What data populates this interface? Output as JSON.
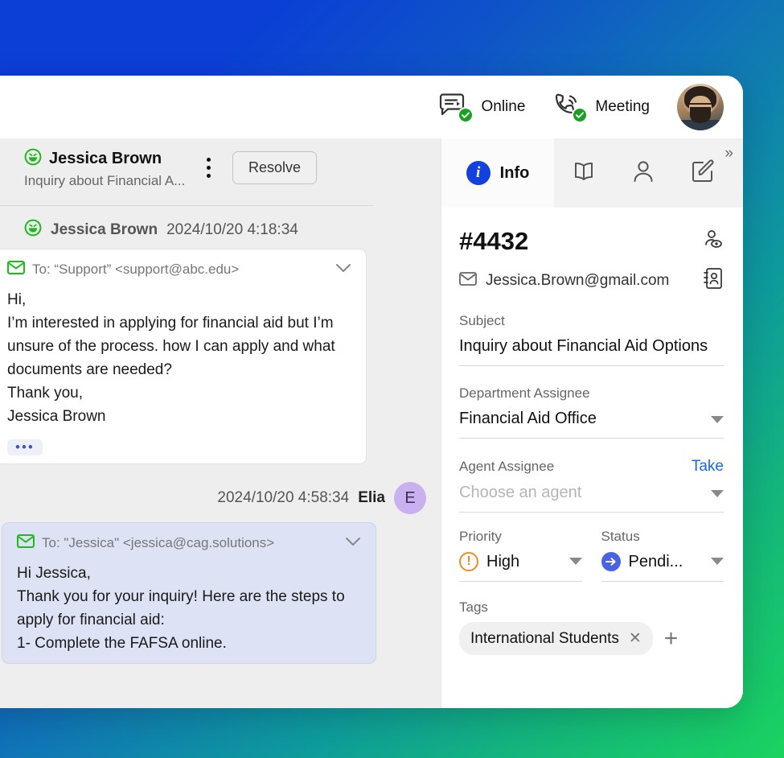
{
  "topbar": {
    "statuses": [
      {
        "label": "Online",
        "icon": "chat-status-icon"
      },
      {
        "label": "Meeting",
        "icon": "phone-status-icon"
      }
    ],
    "avatar_alt": "user-avatar"
  },
  "conversation": {
    "header": {
      "contact_name": "Jessica Brown",
      "subject_preview": "Inquiry about Financial A...",
      "resolve_label": "Resolve",
      "kebab_label": "more-options"
    },
    "messages": [
      {
        "sender": "Jessica Brown",
        "timestamp": "2024/10/20 4:18:34",
        "direction": "incoming",
        "to_line": "To: “Support” <support@abc.edu>",
        "body": "Hi,\nI’m interested in applying for financial aid but I’m unsure of the process. how I can apply and what documents are needed?\nThank you,\nJessica Brown",
        "more_label": "•••"
      },
      {
        "sender": "Elia",
        "avatar_letter": "E",
        "timestamp": "2024/10/20 4:58:34",
        "direction": "outgoing",
        "to_line": "To: \"Jessica\" <jessica@cag.solutions>",
        "body": "Hi Jessica,\nThank you for your inquiry! Here are the steps to apply for financial aid:\n1- Complete the FAFSA online."
      }
    ]
  },
  "info_panel": {
    "tabs": [
      {
        "label": "Info",
        "icon": "info-icon",
        "active": true
      },
      {
        "label": "",
        "icon": "book-icon",
        "active": false
      },
      {
        "label": "",
        "icon": "person-icon",
        "active": false
      },
      {
        "label": "",
        "icon": "compose-icon",
        "active": false
      }
    ],
    "expand_label": "»",
    "ticket_id": "#4432",
    "customer_email": "Jessica.Brown@gmail.com",
    "subject_label": "Subject",
    "subject_value": "Inquiry about Financial Aid Options",
    "department_label": "Department Assignee",
    "department_value": "Financial Aid Office",
    "agent_label": "Agent Assignee",
    "agent_placeholder": "Choose an agent",
    "take_label": "Take",
    "priority_label": "Priority",
    "priority_value": "High",
    "status_label": "Status",
    "status_value": "Pendi...",
    "tags_label": "Tags",
    "tags": [
      "International Students"
    ],
    "add_tag_label": "+"
  },
  "colors": {
    "accent_blue": "#1241dd",
    "link_blue": "#1565ff",
    "priority_orange": "#ef8b26",
    "status_blue": "#4763e4",
    "online_green": "#16a31e",
    "bg_gradient_start": "#0b3fd6",
    "bg_gradient_end": "#1ad35f"
  }
}
